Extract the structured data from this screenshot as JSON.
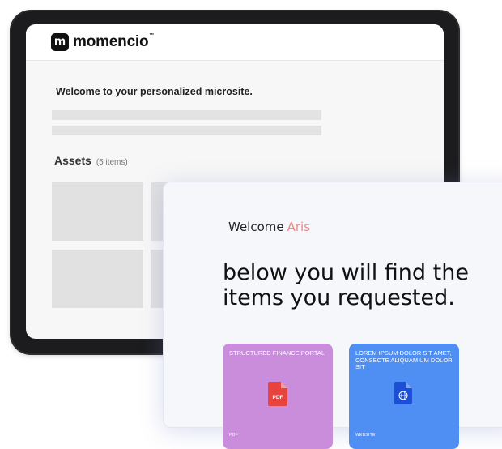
{
  "brand": {
    "logo_letter": "m",
    "name": "momencio",
    "tm": "™"
  },
  "microsite": {
    "welcome": "Welcome to your personalized microsite.",
    "assets_title": "Assets",
    "assets_count": "(5 items)"
  },
  "overlay": {
    "welcome_label": "Welcome",
    "user_name": "Aris",
    "headline": "below you will find the items you requested."
  },
  "items": [
    {
      "title": "STRUCTURED FINANCE PORTAL",
      "badge": "PDF",
      "type": "PDF",
      "color": "#c98ddc",
      "icon": "pdf-file-icon"
    },
    {
      "title": "LOREM IPSUM DOLOR SIT AMET, CONSECTE ALIQUAM UM DOLOR SIT",
      "badge": "",
      "type": "WEBSITE",
      "color": "#4f8ef3",
      "icon": "website-globe-icon"
    }
  ],
  "colors": {
    "accent_name": "#ee8a8a",
    "tablet_frame": "#2d2d30"
  }
}
